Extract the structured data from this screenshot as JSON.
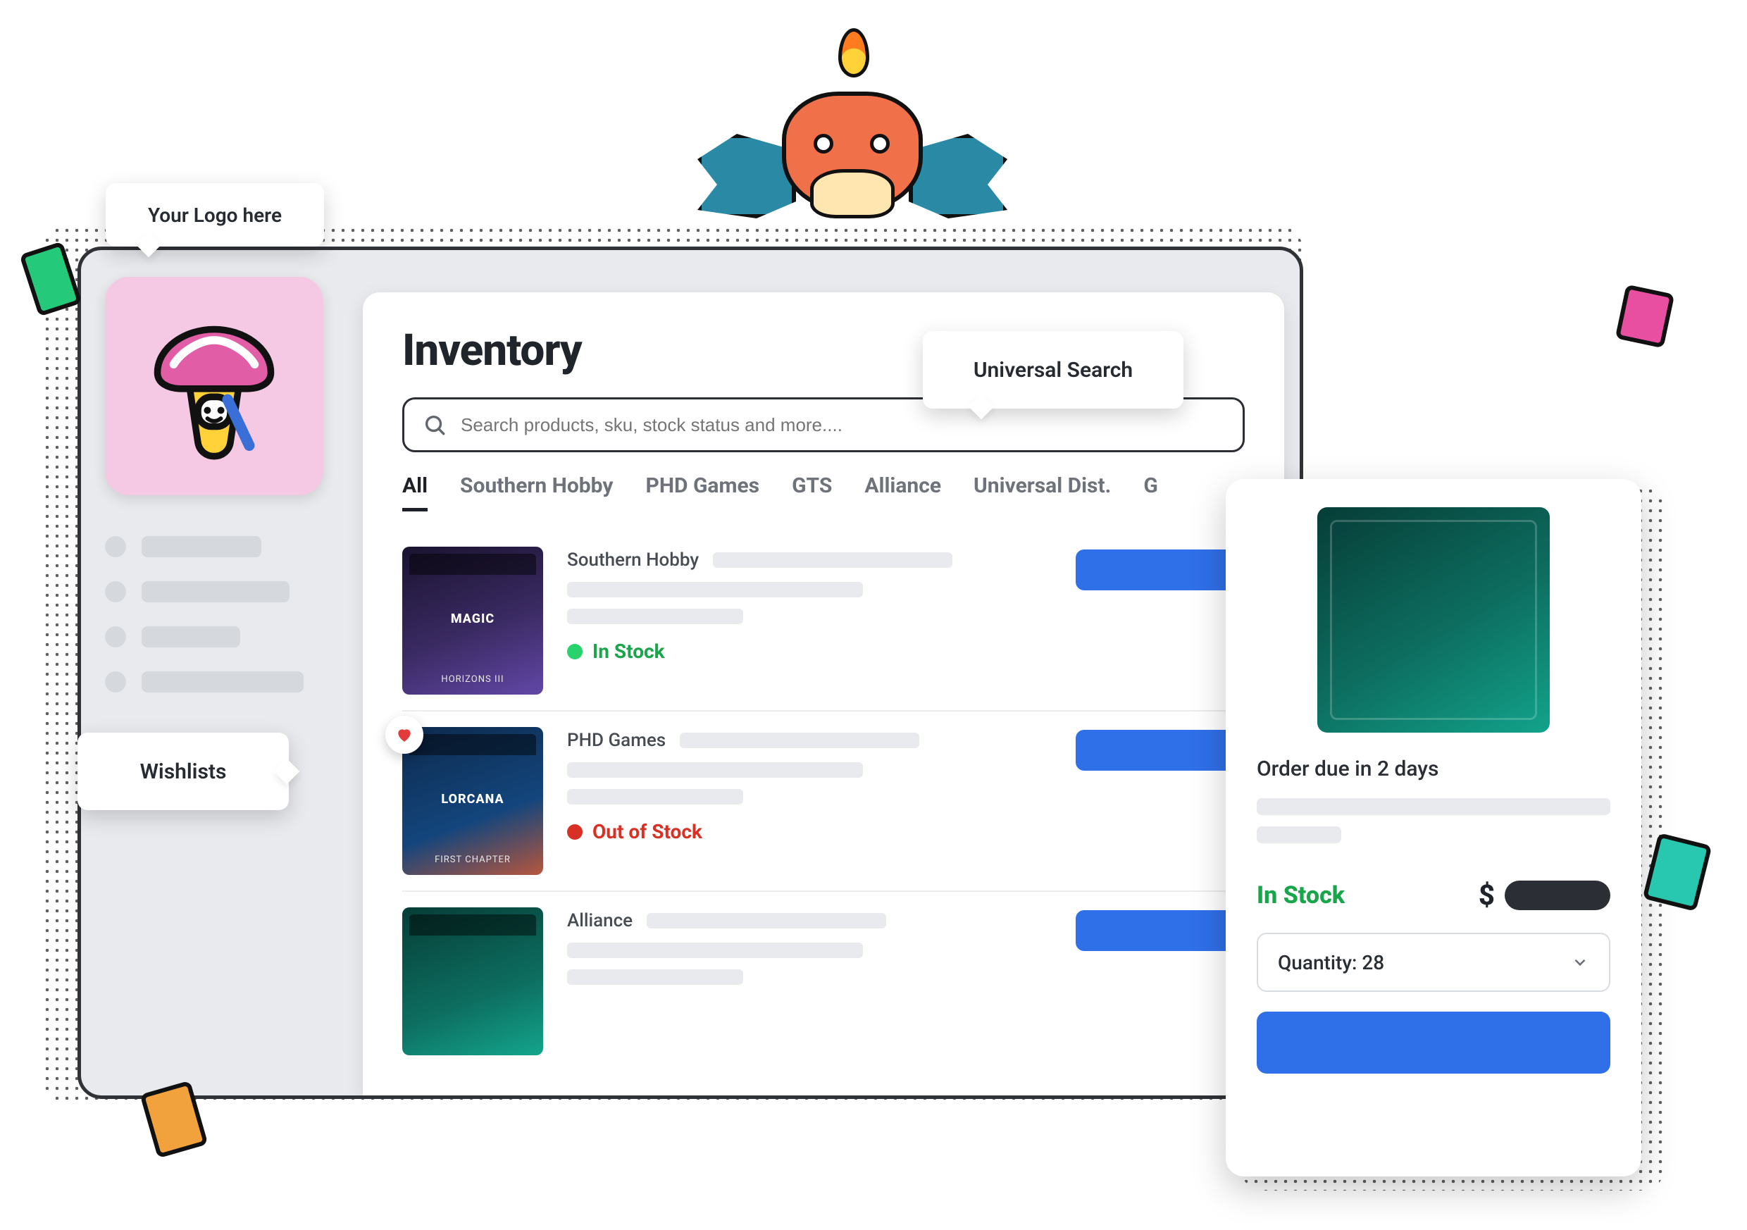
{
  "labels": {
    "logo_hint": "Your Logo here",
    "search_hint": "Universal Search",
    "wishlist_hint": "Wishlists"
  },
  "page": {
    "title": "Inventory",
    "search_placeholder": "Search products, sku, stock status and more....",
    "tabs": [
      "All",
      "Southern Hobby",
      "PHD Games",
      "GTS",
      "Alliance",
      "Universal Dist.",
      "G"
    ]
  },
  "products": [
    {
      "distributor": "Southern Hobby",
      "status": "In Stock",
      "status_kind": "in",
      "thumb_line1": "MAGIC",
      "thumb_line2": "HORIZONS III",
      "favorite": false
    },
    {
      "distributor": "PHD Games",
      "status": "Out of Stock",
      "status_kind": "out",
      "thumb_line1": "LORCANA",
      "thumb_line2": "FIRST CHAPTER",
      "favorite": true
    },
    {
      "distributor": "Alliance",
      "status": "",
      "status_kind": "",
      "thumb_line1": "",
      "thumb_line2": "",
      "favorite": false
    }
  ],
  "detail": {
    "due_text": "Order due in 2 days",
    "stock_text": "In Stock",
    "currency": "$",
    "quantity_label": "Quantity: 28"
  }
}
